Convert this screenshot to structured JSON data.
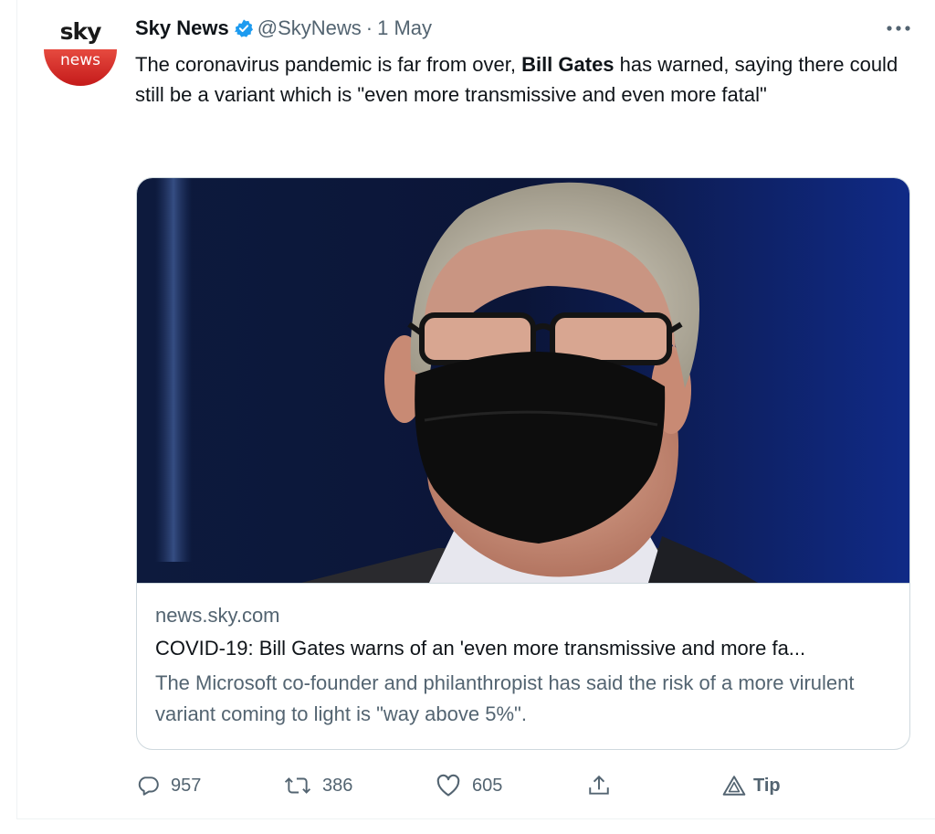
{
  "account": {
    "logo_top": "sky",
    "logo_bottom": "news",
    "name": "Sky News",
    "handle": "@SkyNews",
    "separator": "·",
    "date": "1 May"
  },
  "tweet": {
    "text_part1": "The coronavirus pandemic is far from over, ",
    "text_bold": "Bill Gates",
    "text_part2": " has warned, saying there could still be a variant which is \"even more transmissive and even more fatal\""
  },
  "card": {
    "domain": "news.sky.com",
    "title": "COVID-19: Bill Gates warns of an 'even more transmissive and more fa...",
    "description": "The Microsoft co-founder and philanthropist has said the risk of a more virulent variant coming to light is \"way above 5%\"."
  },
  "actions": {
    "replies": "957",
    "retweets": "386",
    "likes": "605",
    "tip_label": "Tip"
  },
  "icons": {
    "verified": "verified-badge-icon",
    "more": "more-dots-icon",
    "reply": "reply-bubble-icon",
    "retweet": "retweet-icon",
    "like": "heart-icon",
    "share": "share-upload-icon",
    "tip": "tip-triangle-icon"
  },
  "colors": {
    "verified_blue": "#1d9bf0",
    "text_primary": "#0f1419",
    "text_secondary": "#536471",
    "sky_red": "#c41a1a",
    "border": "#cfd9de"
  }
}
